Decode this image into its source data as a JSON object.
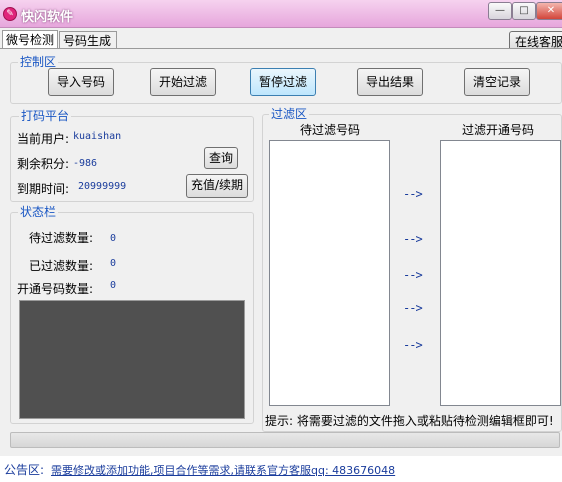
{
  "window": {
    "title": "快闪软件",
    "icon_glyph": "✎",
    "minimize_glyph": "—",
    "restore_glyph": "□",
    "close_glyph": "✕"
  },
  "tabs": [
    {
      "label": "微号检测",
      "selected": true
    },
    {
      "label": "号码生成",
      "selected": false
    }
  ],
  "online_service_button": "在线客服",
  "control_area": {
    "label": "控制区",
    "buttons": [
      "导入号码",
      "开始过滤",
      "暂停过滤",
      "导出结果",
      "清空记录"
    ],
    "active_button_index": 2
  },
  "platform": {
    "label": "打码平台",
    "current_user_label": "当前用户:",
    "current_user_value": "kuaishan",
    "points_label": "剩余积分:",
    "points_value": "-986",
    "expiry_label": "到期时间:",
    "expiry_value": "20999999",
    "query_button": "查询",
    "recharge_button": "充值/续期"
  },
  "status": {
    "label": "状态栏",
    "pending_label": "待过滤数量:",
    "pending_value": "0",
    "filtered_label": "已过滤数量:",
    "filtered_value": "0",
    "opened_label": "开通号码数量:",
    "opened_value": "0"
  },
  "filter_area": {
    "label": "过滤区",
    "left_list_title": "待过滤号码",
    "right_list_title": "过滤开通号码",
    "arrow_glyph": "-->",
    "hint": "提示: 将需要过滤的文件拖入或粘贴待检测编辑框即可!"
  },
  "bulletin": {
    "label": "公告区:",
    "text": "需要修改或添加功能,项目合作等需求,请联系官方客服qq: 483676048"
  },
  "colors": {
    "titlebar": "#e6a6dc",
    "group_label": "#1a57c4",
    "value_text": "#1a3c9c",
    "status_box": "#505050"
  }
}
